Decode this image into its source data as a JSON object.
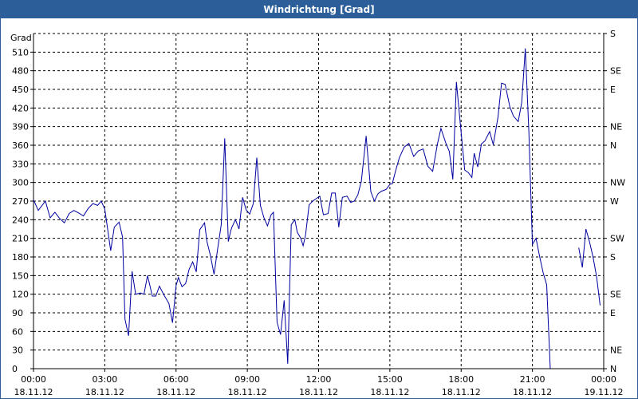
{
  "window": {
    "title": "Windrichtung [Grad]"
  },
  "chart_data": {
    "type": "line",
    "title": "Windrichtung [Grad]",
    "ylabel": "Grad",
    "ylim": [
      0,
      540
    ],
    "y_ticks": [
      0,
      30,
      60,
      90,
      120,
      150,
      180,
      210,
      240,
      270,
      300,
      330,
      360,
      390,
      420,
      450,
      480,
      510
    ],
    "right_axis_labels": [
      {
        "value": 0,
        "label": "N"
      },
      {
        "value": 30,
        "label": "NE"
      },
      {
        "value": 90,
        "label": "E"
      },
      {
        "value": 120,
        "label": "SE"
      },
      {
        "value": 180,
        "label": "S"
      },
      {
        "value": 210,
        "label": "SW"
      },
      {
        "value": 270,
        "label": "W"
      },
      {
        "value": 300,
        "label": "NW"
      },
      {
        "value": 360,
        "label": "N"
      },
      {
        "value": 390,
        "label": "NE"
      },
      {
        "value": 450,
        "label": "E"
      },
      {
        "value": 480,
        "label": "SE"
      },
      {
        "value": 540,
        "label": "S"
      }
    ],
    "x_ticks": [
      {
        "time": "00:00",
        "date": "18.11.12"
      },
      {
        "time": "03:00",
        "date": "18.11.12"
      },
      {
        "time": "06:00",
        "date": "18.11.12"
      },
      {
        "time": "09:00",
        "date": "18.11.12"
      },
      {
        "time": "12:00",
        "date": "18.11.12"
      },
      {
        "time": "15:00",
        "date": "18.11.12"
      },
      {
        "time": "18:00",
        "date": "18.11.12"
      },
      {
        "time": "21:00",
        "date": "18.11.12"
      },
      {
        "time": "00:00",
        "date": "19.11.12"
      }
    ],
    "grid": true,
    "line_color": "#0000a0",
    "series": [
      {
        "x_hours": [
          0.0,
          0.2,
          0.5,
          0.7,
          0.9,
          1.1,
          1.3,
          1.5,
          1.7,
          1.9,
          2.1,
          2.3,
          2.5,
          2.7,
          2.85,
          3.0,
          3.1,
          3.25,
          3.4,
          3.6,
          3.75,
          3.85,
          4.0,
          4.15,
          4.3,
          4.5,
          4.65,
          4.8,
          5.0,
          5.15,
          5.3,
          5.5,
          5.7,
          5.85,
          6.0,
          6.1,
          6.25,
          6.4,
          6.55,
          6.7,
          6.85,
          7.0,
          7.2,
          7.3,
          7.45,
          7.6,
          7.75,
          7.9,
          8.05,
          8.2,
          8.3,
          8.35,
          8.5,
          8.65,
          8.8,
          8.95,
          9.1,
          9.25,
          9.4,
          9.55,
          9.7,
          9.85,
          10.0,
          10.1,
          10.25,
          10.4,
          10.55,
          10.7,
          10.85,
          11.0,
          11.1,
          11.25,
          11.35,
          11.45,
          11.6,
          11.75,
          11.9,
          12.05,
          12.2,
          12.4,
          12.55,
          12.7,
          12.85,
          13.0,
          13.2,
          13.35,
          13.5,
          13.65,
          13.8,
          14.0,
          14.2,
          14.35,
          14.5,
          14.65,
          14.85,
          15.0,
          15.1,
          15.25,
          15.4,
          15.6,
          15.8,
          16.0,
          16.2,
          16.4,
          16.6,
          16.8,
          17.0,
          17.15,
          17.35,
          17.5,
          17.65,
          17.8,
          17.95,
          18.15,
          18.3,
          18.45,
          18.55,
          18.7,
          18.85,
          19.0,
          19.2,
          19.35,
          19.55,
          19.7,
          19.85,
          20.05,
          20.2,
          20.4,
          20.55,
          20.7,
          20.85,
          21.0,
          21.15,
          21.3,
          21.45,
          21.6,
          21.75,
          21.85,
          22.0,
          22.15,
          22.3,
          22.45,
          22.6
        ],
        "values": [
          272,
          255,
          270,
          243,
          252,
          242,
          235,
          250,
          255,
          251,
          246,
          258,
          266,
          263,
          270,
          257,
          230,
          190,
          228,
          236,
          212,
          80,
          53,
          157,
          120,
          122,
          120,
          150,
          117,
          117,
          133,
          118,
          105,
          74,
          134,
          147,
          132,
          137,
          160,
          172,
          156,
          224,
          235,
          205,
          182,
          152,
          193,
          232,
          371,
          205,
          222,
          228,
          240,
          225,
          276,
          256,
          249,
          266,
          340,
          263,
          243,
          230,
          248,
          252,
          75,
          55,
          110,
          8,
          232,
          240,
          220,
          210,
          198,
          215,
          264,
          270,
          274,
          278,
          248,
          250,
          283,
          283,
          228,
          276,
          278,
          268,
          270,
          280,
          302,
          375,
          285,
          270,
          282,
          286,
          289,
          297,
          298,
          320,
          340,
          357,
          363,
          342,
          351,
          354,
          326,
          318,
          362,
          387,
          364,
          350,
          305,
          462,
          400,
          320,
          316,
          308,
          347,
          325,
          362,
          367,
          382,
          361,
          405,
          460,
          458,
          422,
          407,
          398,
          429,
          516,
          380,
          200,
          210,
          181,
          155,
          135,
          0
        ]
      },
      {
        "x_hours": [
          22.95,
          23.1,
          23.25,
          23.4,
          23.55,
          23.7,
          23.85
        ],
        "values": [
          195,
          163,
          225,
          205,
          180,
          148,
          102
        ]
      }
    ]
  }
}
